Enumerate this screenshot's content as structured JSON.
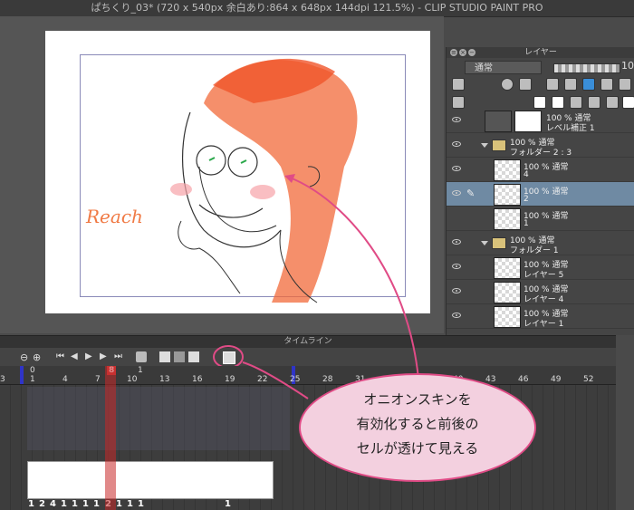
{
  "window": {
    "title": "ぱちくり_03* (720 x 540px 余白あり:864 x 648px 144dpi 121.5%) - CLIP STUDIO PAINT PRO"
  },
  "layer_panel": {
    "title": "レイヤー",
    "blend_mode": "通常",
    "opacity_value": "10",
    "layers": [
      {
        "line1": "100 % 通常",
        "line2": "レベル補正 1",
        "type": "adjust"
      },
      {
        "line1": "100 % 通常",
        "line2": "フォルダー 2 : 3",
        "type": "folder"
      },
      {
        "line1": "100 % 通常",
        "line2": "4",
        "type": "raster"
      },
      {
        "line1": "100 % 通常",
        "line2": "2",
        "type": "raster",
        "selected": true
      },
      {
        "line1": "100 % 通常",
        "line2": "1",
        "type": "raster"
      },
      {
        "line1": "100 % 通常",
        "line2": "フォルダー 1",
        "type": "folder"
      },
      {
        "line1": "100 % 通常",
        "line2": "レイヤー 5",
        "type": "raster"
      },
      {
        "line1": "100 % 通常",
        "line2": "レイヤー 4",
        "type": "raster"
      },
      {
        "line1": "100 % 通常",
        "line2": "レイヤー 1",
        "type": "raster"
      }
    ]
  },
  "timeline": {
    "title": "タイムライン",
    "current_frame": "8",
    "ruler_top": [
      "1"
    ],
    "ruler": [
      "3",
      "1",
      "4",
      "7",
      "10",
      "13",
      "16",
      "19",
      "22",
      "25",
      "28",
      "31",
      "34",
      "37",
      "40",
      "43",
      "46",
      "49",
      "52"
    ],
    "top_marker": "0",
    "cell_numbers": [
      "1",
      "2",
      "4",
      "1",
      "1",
      "1",
      "1",
      "2",
      "1",
      "1",
      "1",
      "1"
    ]
  },
  "callout": {
    "text_lines": [
      "オニオンスキンを",
      "有効化すると前後の",
      "セルが透けて見える"
    ],
    "color": "#e04b86"
  },
  "artwork": {
    "signature_text": "Reach"
  }
}
